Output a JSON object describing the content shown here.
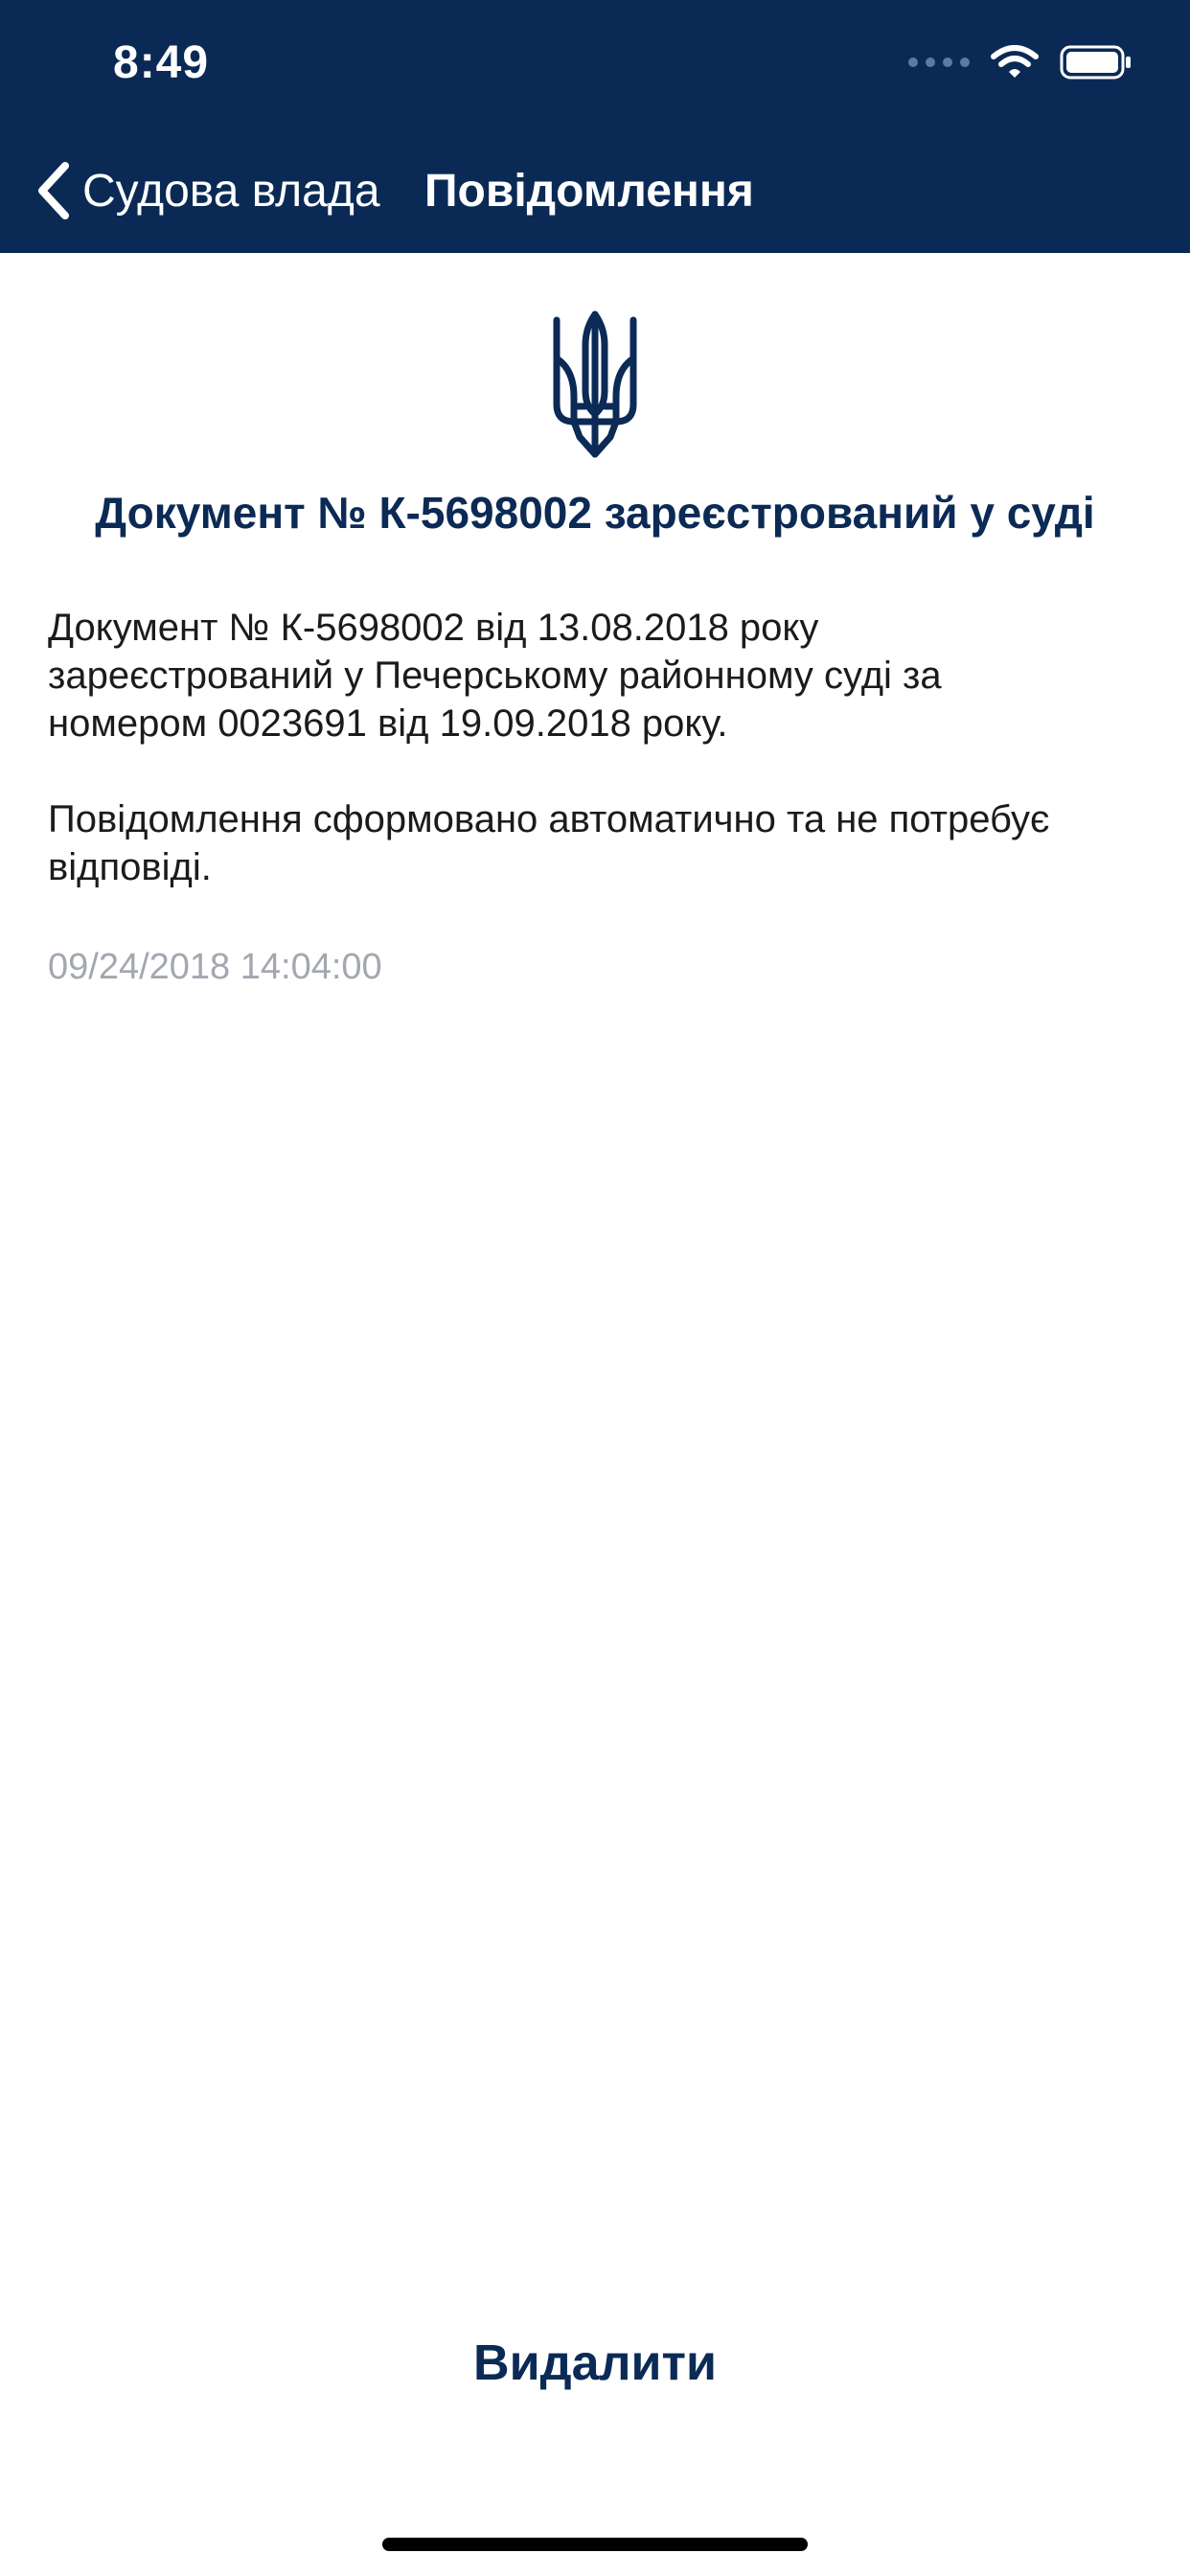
{
  "status_bar": {
    "time": "8:49"
  },
  "nav": {
    "back_label": "Судова влада",
    "title": "Повідомлення"
  },
  "message": {
    "title": "Документ № К-5698002 зареєстрований у суді",
    "body_1": "Документ № К-5698002 від 13.08.2018 року зареєстрований у Печерському районному суді за номером 0023691 від 19.09.2018 року.",
    "body_2": "Повідомлення сформовано автоматично та не потребує відповіді.",
    "timestamp": "09/24/2018 14:04:00"
  },
  "actions": {
    "delete_label": "Видалити"
  },
  "icons": {
    "back": "chevron-left-icon",
    "emblem": "trident-emblem-icon",
    "wifi": "wifi-icon",
    "battery": "battery-icon"
  },
  "colors": {
    "header_bg": "#0a2a55",
    "title_text": "#0b2a55",
    "body_text": "#1b1b1b",
    "timestamp_text": "#a3a7b0",
    "home_indicator": "#000000"
  }
}
